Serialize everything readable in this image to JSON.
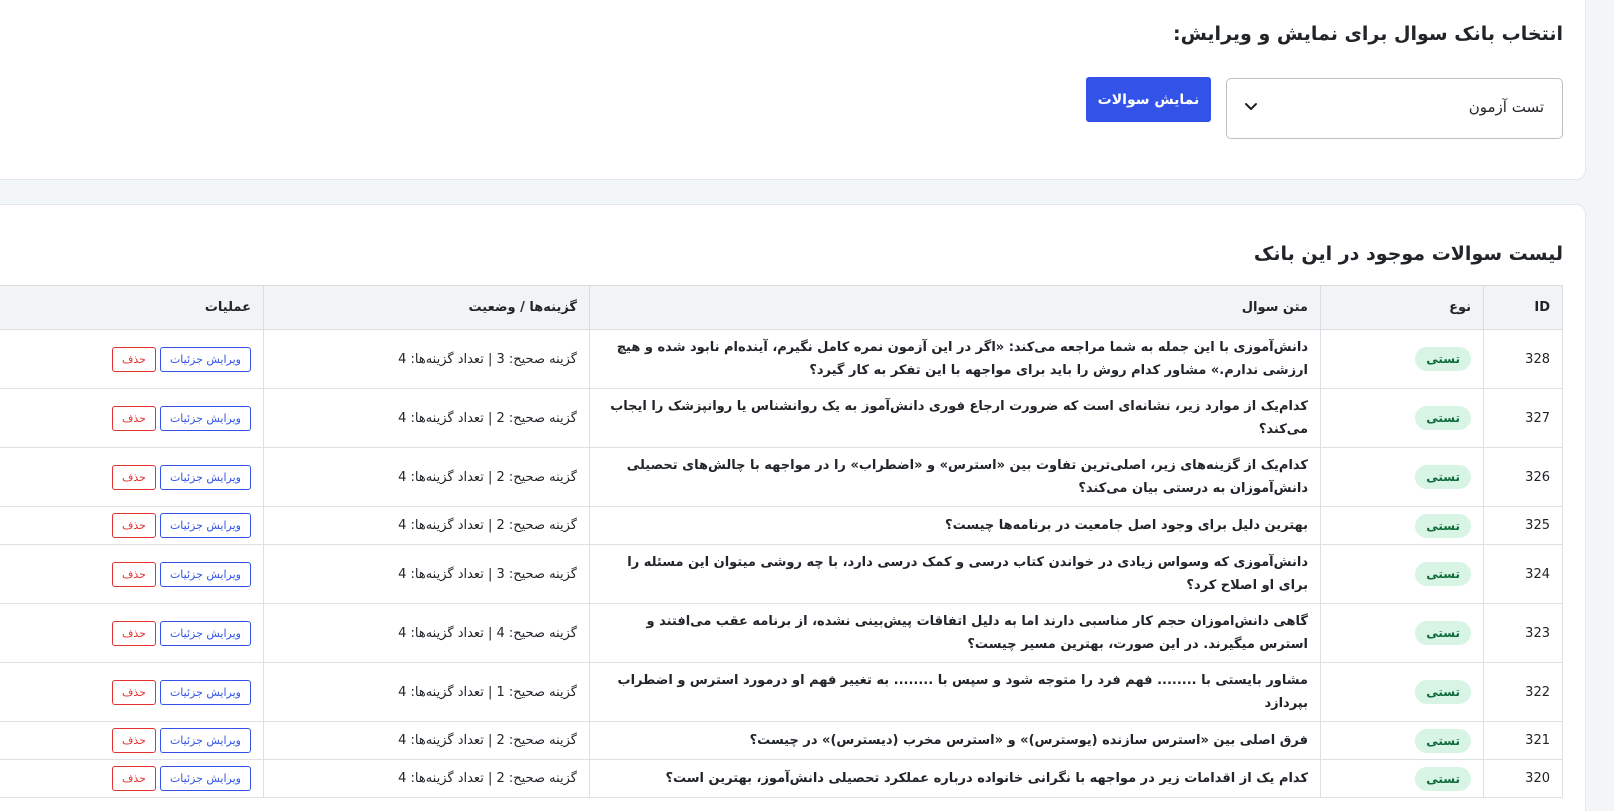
{
  "bank_select": {
    "title": "انتخاب بانک سوال برای نمایش و ویرایش:",
    "selected": "تست آزمون",
    "show_button": "نمایش سوالات"
  },
  "questions_list": {
    "title": "لیست سوالات موجود در این بانک",
    "headers": {
      "id": "ID",
      "type": "نوع",
      "text": "متن سوال",
      "options": "گزینه‌ها / وضعیت",
      "actions": "عملیات"
    },
    "edit_label": "ویرایش جزئیات",
    "delete_label": "حذف",
    "rows": [
      {
        "id": "328",
        "type": "تستی",
        "text": "دانش‌آموزی با این جمله به شما مراجعه می‌کند: «اگر در این آزمون نمره کامل نگیرم، آینده‌ام نابود شده و هیچ ارزشی ندارم.» مشاور کدام روش را باید برای مواجهه با این تفکر به کار گیرد؟",
        "options": "گزینه صحیح: 3 | تعداد گزینه‌ها: 4"
      },
      {
        "id": "327",
        "type": "تستی",
        "text": "کدام‌یک از موارد زیر، نشانه‌ای است که ضرورت ارجاع فوری دانش‌آموز به یک روانشناس یا روانپزشک را ایجاب می‌کند؟",
        "options": "گزینه صحیح: 2 | تعداد گزینه‌ها: 4"
      },
      {
        "id": "326",
        "type": "تستی",
        "text": "کدام‌یک از گزینه‌های زیر، اصلی‌ترین تفاوت بین «استرس» و «اضطراب» را در مواجهه با چالش‌های تحصیلی دانش‌آموزان به درستی بیان می‌کند؟",
        "options": "گزینه صحیح: 2 | تعداد گزینه‌ها: 4"
      },
      {
        "id": "325",
        "type": "تستی",
        "text": "بهترین دلیل برای وجود اصل جامعیت در برنامه‌ها چیست؟",
        "options": "گزینه صحیح: 2 | تعداد گزینه‌ها: 4"
      },
      {
        "id": "324",
        "type": "تستی",
        "text": "دانش‌آموزی که وسواس زیادی در خواندن کتاب درسی و کمک درسی دارد، با چه روشی میتوان این مسئله را برای او اصلاح کرد؟",
        "options": "گزینه صحیح: 3 | تعداد گزینه‌ها: 4"
      },
      {
        "id": "323",
        "type": "تستی",
        "text": "گاهی دانش‌اموزان حجم کار مناسبی دارند اما به دلیل اتفاقات پیش‌بینی نشده، از برنامه عقب می‌افتند و استرس میگیرند. در این صورت، بهترین مسیر چیست؟",
        "options": "گزینه صحیح: 4 | تعداد گزینه‌ها: 4"
      },
      {
        "id": "322",
        "type": "تستی",
        "text": "مشاور بایستی با ........ فهم فرد را متوجه شود و سپس با ........ به تغییر فهم او درمورد استرس و اضطراب بپردازد",
        "options": "گزینه صحیح: 1 | تعداد گزینه‌ها: 4"
      },
      {
        "id": "321",
        "type": "تستی",
        "text": "فرق اصلی بین «استرس سازنده (یوسترس)» و «استرس مخرب (دیسترس)» در چیست؟",
        "options": "گزینه صحیح: 2 | تعداد گزینه‌ها: 4"
      },
      {
        "id": "320",
        "type": "تستی",
        "text": "کدام یک از اقدامات زیر در مواجهه با نگرانی خانواده درباره عملکرد تحصیلی دانش‌آموز، بهترین است؟",
        "options": "گزینه صحیح: 2 | تعداد گزینه‌ها: 4"
      }
    ]
  }
}
